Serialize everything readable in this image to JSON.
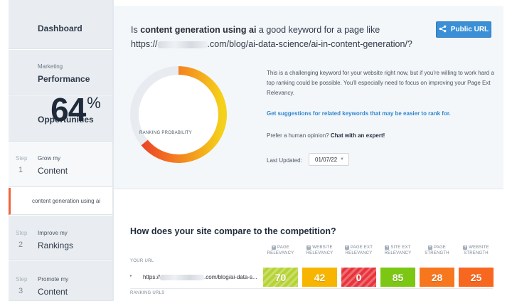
{
  "sidebar": {
    "dashboard": "Dashboard",
    "marketing_small": "Marketing",
    "marketing_big": "Performance",
    "opportunities": "Opportunities",
    "steps": [
      {
        "step_word": "Step",
        "num": "1",
        "small": "Grow my",
        "big": "Content"
      },
      {
        "step_word": "Step",
        "num": "2",
        "small": "Improve my",
        "big": "Rankings"
      },
      {
        "step_word": "Step",
        "num": "3",
        "small": "Promote my",
        "big": "Content"
      }
    ],
    "sub_item": "content generation using ai"
  },
  "header": {
    "question_prefix": "Is ",
    "keyword": "content generation using ai",
    "question_suffix": " a good keyword for a page like",
    "url_prefix": "https://",
    "url_suffix": ".com/blog/ai-data-science/ai-in-content-generation/?",
    "public_url_button": "Public URL"
  },
  "gauge": {
    "value": 64,
    "value_text": "64",
    "percent_sign": "%",
    "label": "RANKING PROBABILITY",
    "track_color": "#e8ebef"
  },
  "advice": {
    "description": "This is a challenging keyword for your website right now, but if you're willing to work hard a top ranking could be possible. You'll especially need to focus on improving your Page Ext Relevancy.",
    "suggestions_link": "Get suggestions for related keywords that may be easier to rank for.",
    "prefer_text": "Prefer a human opinion? ",
    "chat_link": "Chat with an expert!",
    "last_updated_label": "Last Updated:",
    "last_updated_value": "01/07/22"
  },
  "competition": {
    "title": "How does your site compare to the competition?",
    "columns": [
      {
        "line1": "PAGE",
        "line2": "RELEVANCY"
      },
      {
        "line1": "WEBSITE",
        "line2": "RELEVANCY"
      },
      {
        "line1": "PAGE EXT",
        "line2": "RELEVANCY"
      },
      {
        "line1": "SITE EXT",
        "line2": "RELEVANCY"
      },
      {
        "line1": "PAGE",
        "line2": "STRENGTH"
      },
      {
        "line1": "WEBSITE",
        "line2": "STRENGTH"
      }
    ],
    "your_url_label": "YOUR URL",
    "ranking_urls_label": "RANKING URLS",
    "row_url_prefix": "https://",
    "row_url_suffix": ".com/blog/ai-data-s...",
    "scores": [
      {
        "value": "70",
        "color": "#b5d334",
        "striped": true
      },
      {
        "value": "42",
        "color": "#f7b500",
        "striped": false
      },
      {
        "value": "0",
        "color": "#e8343c",
        "striped": true
      },
      {
        "value": "85",
        "color": "#7cc614",
        "striped": false
      },
      {
        "value": "28",
        "color": "#f7771f",
        "striped": false
      },
      {
        "value": "25",
        "color": "#f7671f",
        "striped": false
      }
    ]
  },
  "colors": {
    "accent_blue": "#3b8fd6",
    "link_blue": "#2f86d0",
    "active_marker": "#f0643c"
  }
}
